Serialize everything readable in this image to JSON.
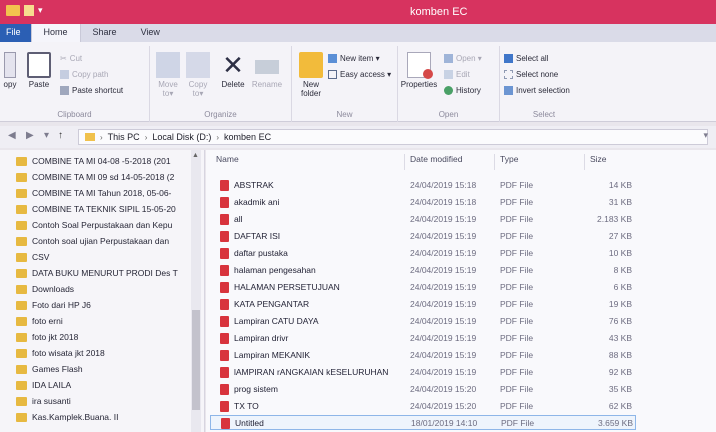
{
  "window": {
    "title": "komben EC"
  },
  "tabs": [
    {
      "label": "File"
    },
    {
      "label": "Home"
    },
    {
      "label": "Share"
    },
    {
      "label": "View"
    }
  ],
  "ribbon": {
    "clipboard": {
      "label": "Clipboard",
      "copy": "opy",
      "paste": "Paste",
      "cut": "Cut",
      "copy_path": "Copy path",
      "paste_shortcut": "Paste shortcut"
    },
    "organize": {
      "label": "Organize",
      "move_to": "Move to▾",
      "copy_to": "Copy to▾",
      "delete": "Delete",
      "rename": "Rename"
    },
    "new": {
      "label": "New",
      "new_folder": "New folder",
      "new_item": "New item ▾",
      "easy_access": "Easy access ▾"
    },
    "open": {
      "label": "Open",
      "properties": "Properties",
      "open": "Open ▾",
      "edit": "Edit",
      "history": "History"
    },
    "select": {
      "label": "Select",
      "select_all": "Select all",
      "select_none": "Select none",
      "invert_selection": "Invert selection"
    }
  },
  "address": {
    "crumbs": [
      "This PC",
      "Local Disk (D:)",
      "komben EC"
    ]
  },
  "nav": {
    "items": [
      "COMBINE TA MI 04-08 -5-2018 (201",
      "COMBINE TA MI 09 sd 14-05-2018 (2",
      "COMBINE TA MI Tahun 2018, 05-06-",
      "COMBINE TA TEKNIK SIPIL 15-05-20",
      "Contoh Soal Perpustakaan dan Kepu",
      "Contoh soal ujian Perpustakaan dan",
      "CSV",
      "DATA BUKU MENURUT PRODI Des T",
      "Downloads",
      "Foto dari HP J6",
      "foto erni",
      "foto jkt 2018",
      "foto wisata jkt 2018",
      "Games Flash",
      "IDA LAILA",
      "ira susanti",
      "Kas.Kamplek.Buana. II"
    ]
  },
  "columns": {
    "name": "Name",
    "date": "Date modified",
    "type": "Type",
    "size": "Size"
  },
  "files": [
    {
      "name": "ABSTRAK",
      "date": "24/04/2019 15:18",
      "type": "PDF File",
      "size": "14 KB"
    },
    {
      "name": "akadmik ani",
      "date": "24/04/2019 15:18",
      "type": "PDF File",
      "size": "31 KB"
    },
    {
      "name": "all",
      "date": "24/04/2019 15:19",
      "type": "PDF File",
      "size": "2.183 KB"
    },
    {
      "name": "DAFTAR ISI",
      "date": "24/04/2019 15:19",
      "type": "PDF File",
      "size": "27 KB"
    },
    {
      "name": "daftar pustaka",
      "date": "24/04/2019 15:19",
      "type": "PDF File",
      "size": "10 KB"
    },
    {
      "name": "halaman pengesahan",
      "date": "24/04/2019 15:19",
      "type": "PDF File",
      "size": "8 KB"
    },
    {
      "name": "HALAMAN PERSETUJUAN",
      "date": "24/04/2019 15:19",
      "type": "PDF File",
      "size": "6 KB"
    },
    {
      "name": "KATA PENGANTAR",
      "date": "24/04/2019 15:19",
      "type": "PDF File",
      "size": "19 KB"
    },
    {
      "name": "Lampiran CATU DAYA",
      "date": "24/04/2019 15:19",
      "type": "PDF File",
      "size": "76 KB"
    },
    {
      "name": "Lampiran drivr",
      "date": "24/04/2019 15:19",
      "type": "PDF File",
      "size": "43 KB"
    },
    {
      "name": "Lampiran MEKANIK",
      "date": "24/04/2019 15:19",
      "type": "PDF File",
      "size": "88 KB"
    },
    {
      "name": "lAMPIRAN rANGKAIAN kESELURUHAN",
      "date": "24/04/2019 15:19",
      "type": "PDF File",
      "size": "92 KB"
    },
    {
      "name": "prog sistem",
      "date": "24/04/2019 15:20",
      "type": "PDF File",
      "size": "35 KB"
    },
    {
      "name": "TX TO",
      "date": "24/04/2019 15:20",
      "type": "PDF File",
      "size": "62 KB"
    },
    {
      "name": "Untitled",
      "date": "18/01/2019 14:10",
      "type": "PDF File",
      "size": "3.659 KB"
    }
  ]
}
